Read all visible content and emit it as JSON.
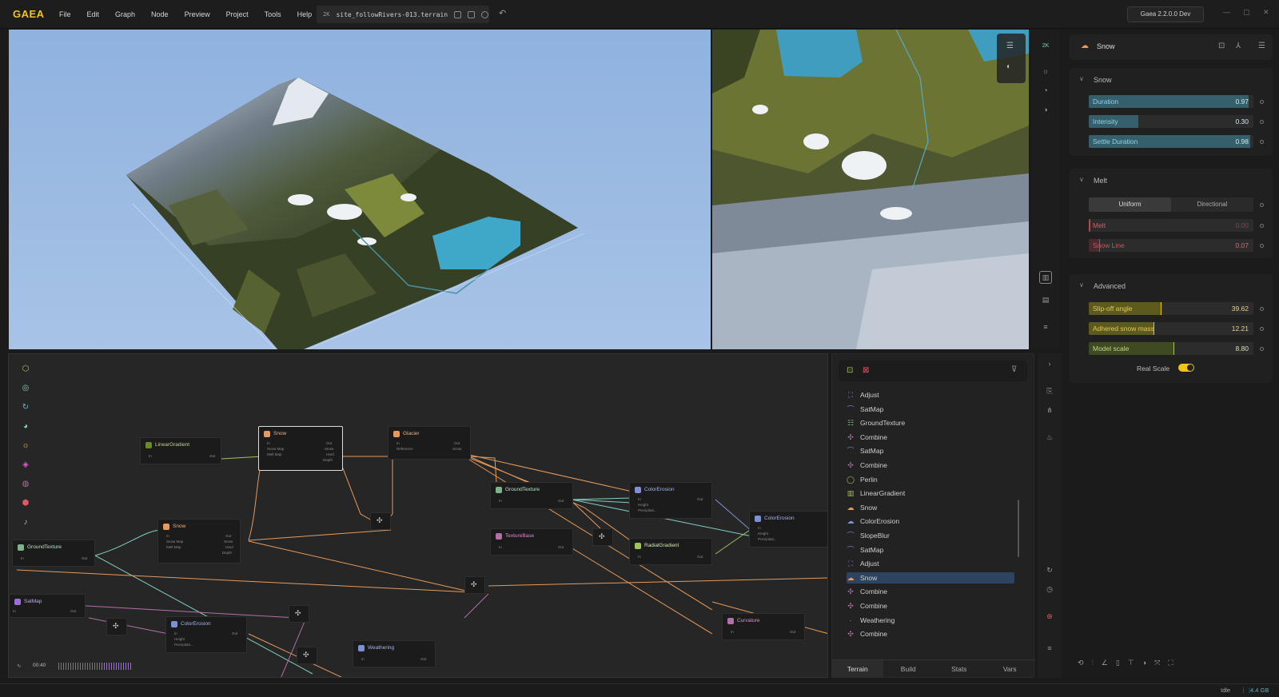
{
  "app": {
    "logo": "GAEA",
    "version": "Gaea 2.2.0.0 Dev"
  },
  "menu": [
    "File",
    "Edit",
    "Graph",
    "Node",
    "Preview",
    "Project",
    "Tools",
    "Help"
  ],
  "file": {
    "resolution": "2K",
    "name": "site_followRivers-013.terrain"
  },
  "viewport_tools": {
    "resolution": "2K"
  },
  "properties": {
    "node_name": "Snow",
    "snow": {
      "title": "Snow",
      "duration": {
        "label": "Duration",
        "value": "0.97",
        "fraction": 0.97
      },
      "intensity": {
        "label": "Intensity",
        "value": "0.30",
        "fraction": 0.3
      },
      "settle": {
        "label": "Settle Duration",
        "value": "0.98",
        "fraction": 0.98
      }
    },
    "melt": {
      "title": "Melt",
      "mode_uniform": "Uniform",
      "mode_directional": "Directional",
      "melt": {
        "label": "Melt",
        "value": "0.00",
        "fraction": 0.0
      },
      "snow_line": {
        "label": "Snow Line",
        "value": "0.07",
        "fraction": 0.07
      }
    },
    "advanced": {
      "title": "Advanced",
      "slip": {
        "label": "Slip-off angle",
        "value": "39.62",
        "fraction": 0.44
      },
      "adhered": {
        "label": "Adhered snow mass",
        "value": "12.21",
        "fraction": 0.4
      },
      "model_scale": {
        "label": "Model scale",
        "value": "8.80",
        "fraction": 0.52
      },
      "real_scale": {
        "label": "Real Scale",
        "on": true
      }
    }
  },
  "graph": {
    "timer": "00:40",
    "nodes": {
      "linear_gradient": {
        "title": "LinearGradient",
        "in": "In",
        "out": "Out"
      },
      "snow_main": {
        "title": "Snow",
        "ports_in": [
          "In",
          "Snow Map",
          "Melt Map"
        ],
        "ports_out": [
          "Out",
          "Snow",
          "Hard",
          "Depth"
        ]
      },
      "glacier": {
        "title": "Glacier",
        "ports_in": [
          "In",
          "Reference"
        ],
        "ports_out": [
          "Out",
          "Snow"
        ]
      },
      "ground_texture_1": {
        "title": "GroundTexture",
        "in": "In",
        "out": "Out"
      },
      "ground_texture_2": {
        "title": "GroundTexture",
        "in": "In",
        "out": "Out"
      },
      "texture_base": {
        "title": "TextureBase",
        "in": "In",
        "out": "Out"
      },
      "color_erosion_1": {
        "title": "ColorErosion",
        "ports_in": [
          "In",
          "Height",
          "Precipitati..."
        ],
        "out": "Out"
      },
      "color_erosion_2": {
        "title": "ColorErosion",
        "ports_in": [
          "In",
          "Height",
          "Precipitati..."
        ]
      },
      "color_erosion_3": {
        "title": "ColorErosion",
        "ports_in": [
          "In",
          "Height",
          "Precipitati..."
        ],
        "out": "Out"
      },
      "radial_gradient": {
        "title": "RadialGradient",
        "in": "In",
        "out": "Out"
      },
      "snow_2": {
        "title": "Snow",
        "ports_in": [
          "In",
          "Snow Map",
          "Melt Map"
        ],
        "ports_out": [
          "Out",
          "Snow",
          "Hard",
          "Depth"
        ]
      },
      "satmap": {
        "title": "SatMap",
        "in": "In",
        "out": "Out"
      },
      "weathering": {
        "title": "Weathering",
        "in": "In",
        "out": "Out"
      },
      "curvature": {
        "title": "Curvature",
        "in": "In",
        "out": "Out"
      }
    }
  },
  "library": {
    "items": [
      {
        "label": "Adjust",
        "icon": "adjust-icon",
        "color": "#9b6fd6"
      },
      {
        "label": "SatMap",
        "icon": "satmap-icon",
        "color": "#9b6fd6"
      },
      {
        "label": "GroundTexture",
        "icon": "texture-icon",
        "color": "#7fb48a"
      },
      {
        "label": "Combine",
        "icon": "combine-icon",
        "color": "#b46fa8"
      },
      {
        "label": "SatMap",
        "icon": "satmap-icon",
        "color": "#9b6fd6"
      },
      {
        "label": "Combine",
        "icon": "combine-icon",
        "color": "#b46fa8"
      },
      {
        "label": "Perlin",
        "icon": "perlin-icon",
        "color": "#a2c25c"
      },
      {
        "label": "LinearGradient",
        "icon": "gradient-icon",
        "color": "#a2c25c"
      },
      {
        "label": "Snow",
        "icon": "snow-icon",
        "color": "#e69a5c"
      },
      {
        "label": "ColorErosion",
        "icon": "erosion-icon",
        "color": "#7f8fd6"
      },
      {
        "label": "SlopeBlur",
        "icon": "slopeblur-icon",
        "color": "#9b6fd6"
      },
      {
        "label": "SatMap",
        "icon": "satmap-icon",
        "color": "#9b6fd6"
      },
      {
        "label": "Adjust",
        "icon": "adjust-icon",
        "color": "#9b6fd6"
      },
      {
        "label": "Snow",
        "icon": "snow-icon",
        "color": "#e69a5c"
      },
      {
        "label": "Combine",
        "icon": "combine-icon",
        "color": "#b46fa8"
      },
      {
        "label": "Combine",
        "icon": "combine-icon",
        "color": "#b46fa8"
      },
      {
        "label": "Weathering",
        "icon": "weathering-icon",
        "color": "#7f8fd6"
      },
      {
        "label": "Combine",
        "icon": "combine-icon",
        "color": "#b46fa8"
      }
    ],
    "selected_index": 13,
    "tabs": [
      "Terrain",
      "Build",
      "Stats",
      "Vars"
    ]
  },
  "status": {
    "state": "Idle",
    "memory": "4.4 GB"
  },
  "colors": {
    "accent": "#f0c419",
    "snow_slider": "#3d7a8a",
    "melt_slider": "#c2414a",
    "advanced_slider": "#5c6a2a"
  }
}
